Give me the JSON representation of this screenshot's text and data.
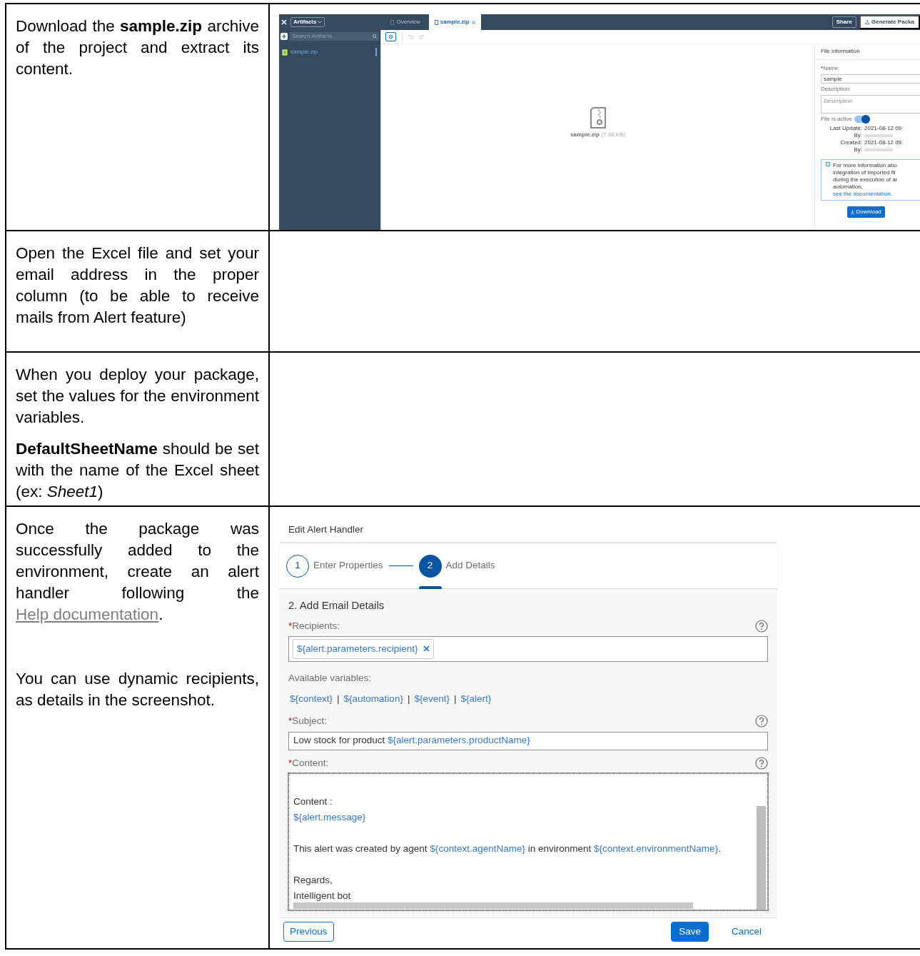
{
  "rows": [
    {
      "instructions": [
        {
          "text": "Download the **sample.zip** archive of the project and extract its content."
        }
      ],
      "screenshot": {
        "kind": "artifact_editor",
        "dropdown": "Artifacts",
        "tabs": [
          {
            "label": "Overview",
            "selected": false
          },
          {
            "label": "sample.zip",
            "selected": true
          }
        ],
        "actions": [
          "Share",
          "Generate Packa"
        ],
        "search": {
          "placeholder": "Search Artifacts"
        },
        "tree": [
          {
            "label": "sample.zip",
            "selected": true
          }
        ],
        "preview": {
          "file": "sample.zip",
          "size": "(7.36 KB)"
        },
        "panel": {
          "title": "File information",
          "name": {
            "marker": "*",
            "label": "Name:",
            "value": "sample"
          },
          "description": {
            "label": "Description:",
            "placeholder": "Description"
          },
          "toggle": {
            "label": "File is active",
            "on": true
          },
          "meta": [
            {
              "label": "Last Update:",
              "value": "2021-08-12 09:"
            },
            {
              "label": "By:",
              "redacted": true
            },
            {
              "label": "Created:",
              "value": "2021-08-12 09:"
            },
            {
              "label": "By:",
              "redacted": true
            }
          ],
          "info": {
            "lines": [
              "For more information abo",
              "integration of imported fil",
              "during the execution of ar",
              "automation,"
            ],
            "link": "see the documentation."
          },
          "button": "Download"
        }
      }
    },
    {
      "instructions": [
        {
          "text": "Open the Excel file and set your email address in the proper column (to be able to receive mails from Alert feature)"
        }
      ]
    },
    {
      "instructions": [
        {
          "text": "When you deploy your package, set the values for the environment variables."
        },
        {
          "text": "**DefaultSheetName** should be set with the name of the Excel sheet (ex: *Sheet1*)"
        }
      ]
    },
    {
      "instructions": [
        {
          "text": "Once the package was successfully added to the environment, create an alert handler following the ",
          "link": "Help documentation",
          "after": "."
        },
        {
          "text": "You can use dynamic recipients, as details in the screenshot."
        }
      ],
      "screenshot": {
        "kind": "alert_handler",
        "title": "Edit Alert Handler",
        "steps": [
          {
            "number": "1",
            "label": "Enter Properties",
            "selected": false
          },
          {
            "number": "2",
            "label": "Add Details",
            "selected": true
          }
        ],
        "section": "2. Add Email Details",
        "recipients": {
          "marker": "*",
          "label": "Recipients:",
          "tokens": [
            "${alert.parameters.recipient}"
          ]
        },
        "variables": {
          "label": "Available variables:",
          "items": [
            "${context}",
            "${automation}",
            "${event}",
            "${alert}"
          ],
          "separator": "|"
        },
        "subject": {
          "marker": "*",
          "label": "Subject:",
          "segments": [
            {
              "kind": "plain",
              "text": "Low stock for product "
            },
            {
              "kind": "variable",
              "text": "${alert.parameters.productName}"
            }
          ]
        },
        "content": {
          "marker": "*",
          "label": "Content:",
          "lines": [
            {
              "space_before": true,
              "segments": [
                {
                  "kind": "plain",
                  "text": "Content :"
                }
              ]
            },
            {
              "space_before": false,
              "segments": [
                {
                  "kind": "variable",
                  "text": "${alert.message}"
                }
              ]
            },
            {
              "space_before": true,
              "segments": [
                {
                  "kind": "plain",
                  "text": "This alert was created by agent "
                },
                {
                  "kind": "variable",
                  "text": "${context.agentName}"
                },
                {
                  "kind": "plain",
                  "text": " in environment "
                },
                {
                  "kind": "variable",
                  "text": "${context.environmentName}"
                },
                {
                  "kind": "plain",
                  "text": "."
                }
              ]
            },
            {
              "space_before": true,
              "segments": [
                {
                  "kind": "plain",
                  "text": "Regards,"
                }
              ]
            },
            {
              "space_before": false,
              "segments": [
                {
                  "kind": "plain",
                  "text": "Intelligent bot"
                }
              ]
            }
          ]
        },
        "footer": [
          {
            "label": "Previous",
            "kind": "outline"
          },
          {
            "label": "Save",
            "kind": "primary"
          },
          {
            "label": "Cancel",
            "kind": "link"
          }
        ]
      }
    }
  ]
}
